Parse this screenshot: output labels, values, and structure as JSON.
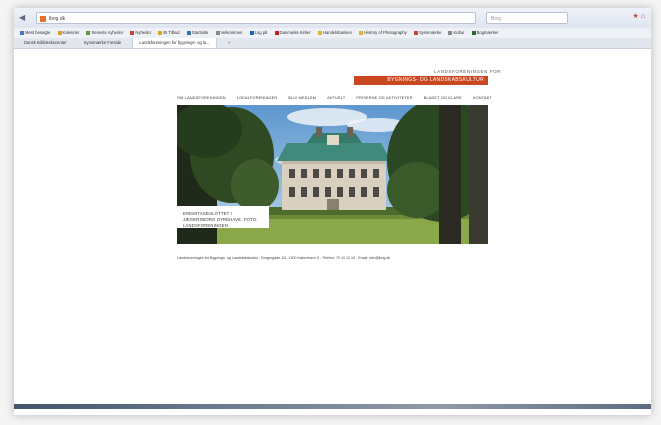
{
  "browser": {
    "url": "lbog.dk",
    "search_placeholder": "Bing",
    "bookmarks": [
      "Mest besøgte",
      "Kalender",
      "Seneste nyheder",
      "Nyheder",
      "BI Tilbud",
      "Startside",
      "Velkommen",
      "Log på",
      "Danmarks Kirker",
      "Handelsbanken",
      "History of Photography",
      "Synsmærke",
      "Kultur",
      "Bogmærker"
    ],
    "tabs": [
      "Dansk Bibliotekscenter",
      "Synsmærke Forside",
      "Landsforeningen for bygnings- og la..."
    ],
    "tab_add": "+"
  },
  "header": {
    "org_line": "LANDSFORENINGEN FOR",
    "org_band": "BYGNINGS- OG LANDSKABSKULTUR"
  },
  "menu": [
    "OM LANDSFORENINGEN",
    "LOKALFORENINGER",
    "BLIV MEDLEM",
    "AKTUELT",
    "PRISERNE OG AKTIVITETER",
    "BLADET OG KLARE",
    "KONTAKT"
  ],
  "hero": {
    "caption": "EREMITAGESLOTTET I JÆGERSBORG DYREHAVE. FOTO: LANDSFORENINGEN."
  },
  "footer": {
    "text": "Landsforeningen for Bygnings- og Landskabskultur - Borgergade 111, 1300 København K - Telefon: 70 10 12 10 - Email: info@lbog.dk"
  },
  "colors": {
    "brand": "#c8471f",
    "sky": "#7fb0d8",
    "lawn": "#8aa84a"
  },
  "icons": {
    "back": "back-arrow-icon",
    "favicon": "favicon-icon",
    "star": "star-icon",
    "home": "home-icon"
  }
}
